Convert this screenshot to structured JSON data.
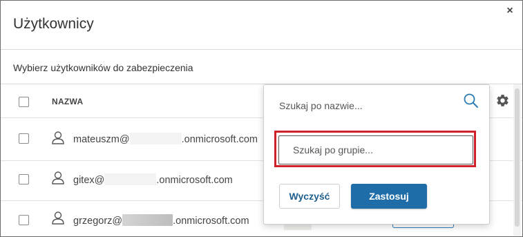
{
  "dialog": {
    "title": "Użytkownicy",
    "close_glyph": "×",
    "subtitle": "Wybierz użytkowników do zabezpieczenia"
  },
  "table": {
    "header": {
      "name": "NAZWA"
    },
    "rows": [
      {
        "user": "mateuszm@",
        "domain": ".onmicrosoft.com"
      },
      {
        "user": "gitex@",
        "domain": ".onmicrosoft.com"
      },
      {
        "user": "grzegorz@",
        "domain": ".onmicrosoft.com"
      }
    ]
  },
  "filter_popup": {
    "name_placeholder": "Szukaj po nazwie...",
    "group_placeholder": "Szukaj po grupie...",
    "clear_label": "Wyczyść",
    "apply_label": "Zastosuj"
  },
  "icons": {
    "close": "close-icon",
    "settings": "gear-icon",
    "search": "search-icon",
    "user": "user-icon"
  },
  "colors": {
    "accent": "#1f6da8",
    "highlight": "#d0202a",
    "search_icon": "#2b7ab3"
  }
}
